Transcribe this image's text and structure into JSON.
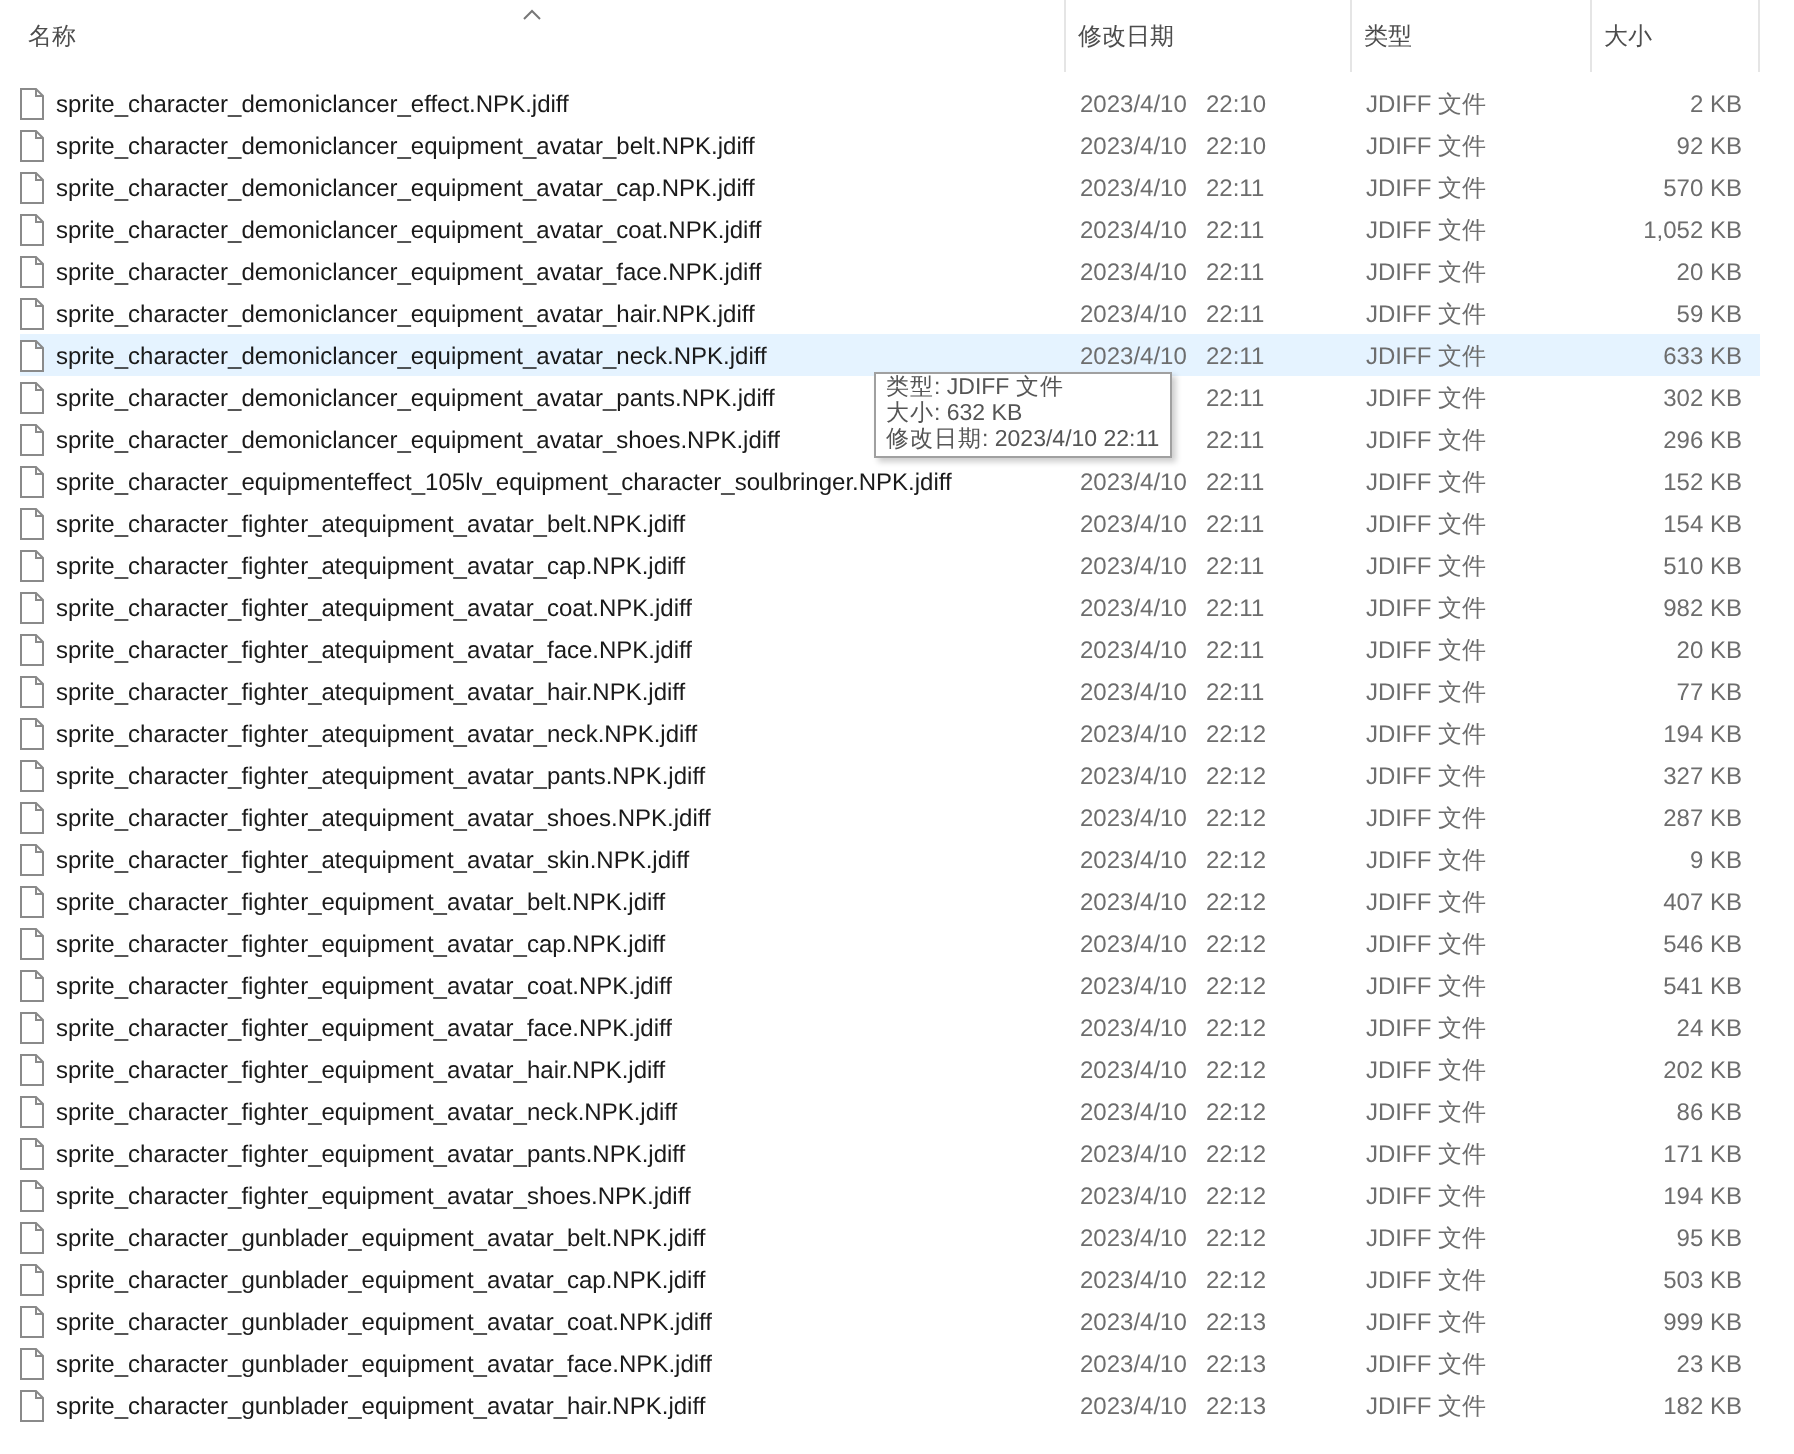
{
  "columns": [
    {
      "label": "名称",
      "sorted": true
    },
    {
      "label": "修改日期",
      "sorted": false
    },
    {
      "label": "类型",
      "sorted": false
    },
    {
      "label": "大小",
      "sorted": false
    }
  ],
  "rows": [
    {
      "name": "sprite_character_demoniclancer_effect.NPK.jdiff",
      "date": "2023/4/10",
      "time": "22:10",
      "type": "JDIFF 文件",
      "size": "2 KB",
      "highlighted": false
    },
    {
      "name": "sprite_character_demoniclancer_equipment_avatar_belt.NPK.jdiff",
      "date": "2023/4/10",
      "time": "22:10",
      "type": "JDIFF 文件",
      "size": "92 KB",
      "highlighted": false
    },
    {
      "name": "sprite_character_demoniclancer_equipment_avatar_cap.NPK.jdiff",
      "date": "2023/4/10",
      "time": "22:11",
      "type": "JDIFF 文件",
      "size": "570 KB",
      "highlighted": false
    },
    {
      "name": "sprite_character_demoniclancer_equipment_avatar_coat.NPK.jdiff",
      "date": "2023/4/10",
      "time": "22:11",
      "type": "JDIFF 文件",
      "size": "1,052 KB",
      "highlighted": false
    },
    {
      "name": "sprite_character_demoniclancer_equipment_avatar_face.NPK.jdiff",
      "date": "2023/4/10",
      "time": "22:11",
      "type": "JDIFF 文件",
      "size": "20 KB",
      "highlighted": false
    },
    {
      "name": "sprite_character_demoniclancer_equipment_avatar_hair.NPK.jdiff",
      "date": "2023/4/10",
      "time": "22:11",
      "type": "JDIFF 文件",
      "size": "59 KB",
      "highlighted": false
    },
    {
      "name": "sprite_character_demoniclancer_equipment_avatar_neck.NPK.jdiff",
      "date": "2023/4/10",
      "time": "22:11",
      "type": "JDIFF 文件",
      "size": "633 KB",
      "highlighted": true
    },
    {
      "name": "sprite_character_demoniclancer_equipment_avatar_pants.NPK.jdiff",
      "time": "22:11",
      "type": "JDIFF 文件",
      "size": "302 KB",
      "highlighted": false
    },
    {
      "name": "sprite_character_demoniclancer_equipment_avatar_shoes.NPK.jdiff",
      "time": "22:11",
      "type": "JDIFF 文件",
      "size": "296 KB",
      "highlighted": false
    },
    {
      "name": "sprite_character_equipmenteffect_105lv_equipment_character_soulbringer.NPK.jdiff",
      "date": "2023/4/10",
      "time": "22:11",
      "type": "JDIFF 文件",
      "size": "152 KB",
      "highlighted": false
    },
    {
      "name": "sprite_character_fighter_atequipment_avatar_belt.NPK.jdiff",
      "date": "2023/4/10",
      "time": "22:11",
      "type": "JDIFF 文件",
      "size": "154 KB",
      "highlighted": false
    },
    {
      "name": "sprite_character_fighter_atequipment_avatar_cap.NPK.jdiff",
      "date": "2023/4/10",
      "time": "22:11",
      "type": "JDIFF 文件",
      "size": "510 KB",
      "highlighted": false
    },
    {
      "name": "sprite_character_fighter_atequipment_avatar_coat.NPK.jdiff",
      "date": "2023/4/10",
      "time": "22:11",
      "type": "JDIFF 文件",
      "size": "982 KB",
      "highlighted": false
    },
    {
      "name": "sprite_character_fighter_atequipment_avatar_face.NPK.jdiff",
      "date": "2023/4/10",
      "time": "22:11",
      "type": "JDIFF 文件",
      "size": "20 KB",
      "highlighted": false
    },
    {
      "name": "sprite_character_fighter_atequipment_avatar_hair.NPK.jdiff",
      "date": "2023/4/10",
      "time": "22:11",
      "type": "JDIFF 文件",
      "size": "77 KB",
      "highlighted": false
    },
    {
      "name": "sprite_character_fighter_atequipment_avatar_neck.NPK.jdiff",
      "date": "2023/4/10",
      "time": "22:12",
      "type": "JDIFF 文件",
      "size": "194 KB",
      "highlighted": false
    },
    {
      "name": "sprite_character_fighter_atequipment_avatar_pants.NPK.jdiff",
      "date": "2023/4/10",
      "time": "22:12",
      "type": "JDIFF 文件",
      "size": "327 KB",
      "highlighted": false
    },
    {
      "name": "sprite_character_fighter_atequipment_avatar_shoes.NPK.jdiff",
      "date": "2023/4/10",
      "time": "22:12",
      "type": "JDIFF 文件",
      "size": "287 KB",
      "highlighted": false
    },
    {
      "name": "sprite_character_fighter_atequipment_avatar_skin.NPK.jdiff",
      "date": "2023/4/10",
      "time": "22:12",
      "type": "JDIFF 文件",
      "size": "9 KB",
      "highlighted": false
    },
    {
      "name": "sprite_character_fighter_equipment_avatar_belt.NPK.jdiff",
      "date": "2023/4/10",
      "time": "22:12",
      "type": "JDIFF 文件",
      "size": "407 KB",
      "highlighted": false
    },
    {
      "name": "sprite_character_fighter_equipment_avatar_cap.NPK.jdiff",
      "date": "2023/4/10",
      "time": "22:12",
      "type": "JDIFF 文件",
      "size": "546 KB",
      "highlighted": false
    },
    {
      "name": "sprite_character_fighter_equipment_avatar_coat.NPK.jdiff",
      "date": "2023/4/10",
      "time": "22:12",
      "type": "JDIFF 文件",
      "size": "541 KB",
      "highlighted": false
    },
    {
      "name": "sprite_character_fighter_equipment_avatar_face.NPK.jdiff",
      "date": "2023/4/10",
      "time": "22:12",
      "type": "JDIFF 文件",
      "size": "24 KB",
      "highlighted": false
    },
    {
      "name": "sprite_character_fighter_equipment_avatar_hair.NPK.jdiff",
      "date": "2023/4/10",
      "time": "22:12",
      "type": "JDIFF 文件",
      "size": "202 KB",
      "highlighted": false
    },
    {
      "name": "sprite_character_fighter_equipment_avatar_neck.NPK.jdiff",
      "date": "2023/4/10",
      "time": "22:12",
      "type": "JDIFF 文件",
      "size": "86 KB",
      "highlighted": false
    },
    {
      "name": "sprite_character_fighter_equipment_avatar_pants.NPK.jdiff",
      "date": "2023/4/10",
      "time": "22:12",
      "type": "JDIFF 文件",
      "size": "171 KB",
      "highlighted": false
    },
    {
      "name": "sprite_character_fighter_equipment_avatar_shoes.NPK.jdiff",
      "date": "2023/4/10",
      "time": "22:12",
      "type": "JDIFF 文件",
      "size": "194 KB",
      "highlighted": false
    },
    {
      "name": "sprite_character_gunblader_equipment_avatar_belt.NPK.jdiff",
      "date": "2023/4/10",
      "time": "22:12",
      "type": "JDIFF 文件",
      "size": "95 KB",
      "highlighted": false
    },
    {
      "name": "sprite_character_gunblader_equipment_avatar_cap.NPK.jdiff",
      "date": "2023/4/10",
      "time": "22:12",
      "type": "JDIFF 文件",
      "size": "503 KB",
      "highlighted": false
    },
    {
      "name": "sprite_character_gunblader_equipment_avatar_coat.NPK.jdiff",
      "date": "2023/4/10",
      "time": "22:13",
      "type": "JDIFF 文件",
      "size": "999 KB",
      "highlighted": false
    },
    {
      "name": "sprite_character_gunblader_equipment_avatar_face.NPK.jdiff",
      "date": "2023/4/10",
      "time": "22:13",
      "type": "JDIFF 文件",
      "size": "23 KB",
      "highlighted": false
    },
    {
      "name": "sprite_character_gunblader_equipment_avatar_hair.NPK.jdiff",
      "date": "2023/4/10",
      "time": "22:13",
      "type": "JDIFF 文件",
      "size": "182 KB",
      "highlighted": false
    }
  ],
  "tooltip": {
    "lines": [
      "类型: JDIFF 文件",
      "大小: 632 KB",
      "修改日期: 2023/4/10 22:11"
    ]
  }
}
